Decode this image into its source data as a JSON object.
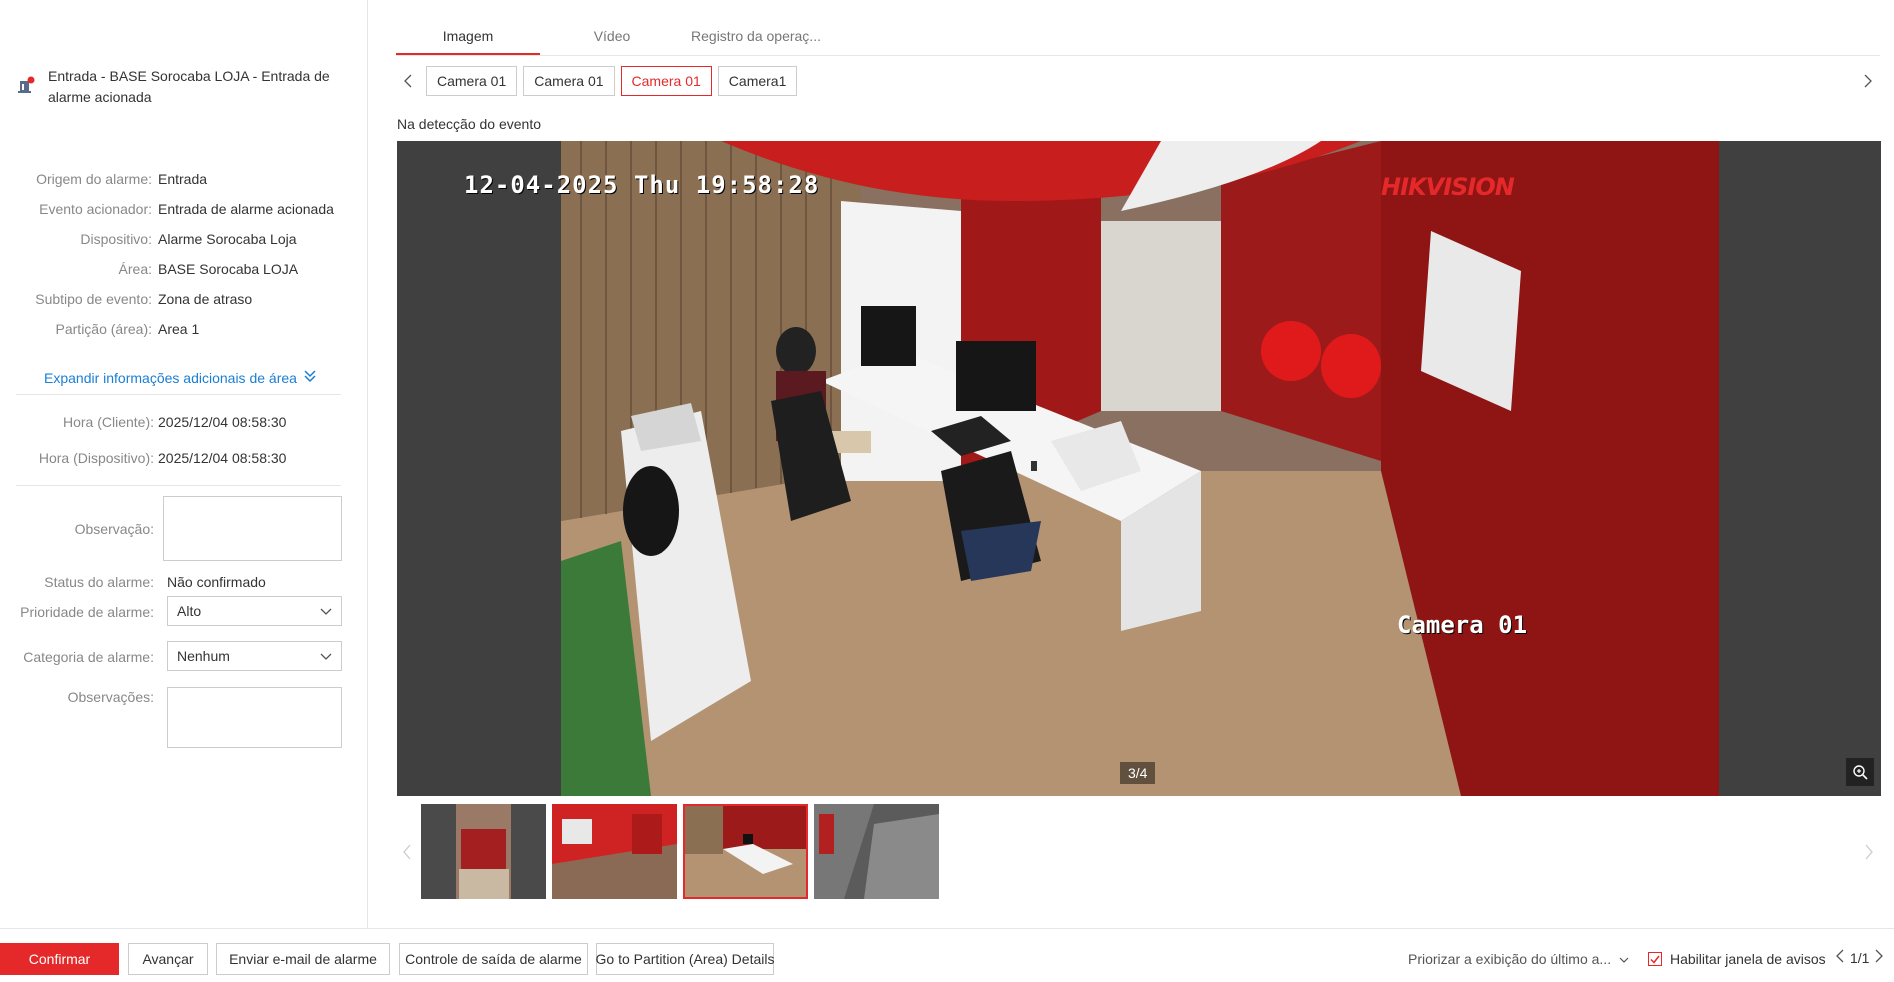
{
  "alarm": {
    "title": "Entrada - BASE Sorocaba LOJA - Entrada de alarme acionada"
  },
  "details": [
    {
      "label": "Origem do alarme:",
      "value": "Entrada"
    },
    {
      "label": "Evento acionador:",
      "value": "Entrada de alarme acionada"
    },
    {
      "label": "Dispositivo:",
      "value": "Alarme Sorocaba Loja"
    },
    {
      "label": "Área:",
      "value": "BASE Sorocaba LOJA"
    },
    {
      "label": "Subtipo de evento:",
      "value": "Zona de atraso"
    },
    {
      "label": "Partição (área):",
      "value": "Area 1"
    }
  ],
  "expand_label": "Expandir informações adicionais de área",
  "times": [
    {
      "label": "Hora (Cliente):",
      "value": "2025/12/04 08:58:30"
    },
    {
      "label": "Hora (Dispositivo):",
      "value": "2025/12/04 08:58:30"
    }
  ],
  "form": {
    "observation_label": "Observação:",
    "status_label": "Status do alarme:",
    "status_value": "Não confirmado",
    "priority_label": "Prioridade de alarme:",
    "priority_value": "Alto",
    "category_label": "Categoria de alarme:",
    "category_value": "Nenhum",
    "remarks_label": "Observações:"
  },
  "tabs": [
    "Imagem",
    "Vídeo",
    "Registro da operaç..."
  ],
  "cameras": [
    "Camera 01",
    "Camera 01",
    "Camera 01",
    "Camera1"
  ],
  "active_camera_index": 2,
  "detect_label": "Na detecção do evento",
  "osd": {
    "timestamp": "12-04-2025 Thu 19:58:28",
    "brand": "HIKVISION",
    "camera": "Camera 01"
  },
  "counter": "3/4",
  "buttons": {
    "confirm": "Confirmar",
    "advance": "Avançar",
    "email": "Enviar e-mail de alarme",
    "output": "Controle de saída de alarme",
    "partition": "Go to Partition (Area) Details"
  },
  "prioritize_label": "Priorizar a exibição do último a...",
  "enable_popup_label": "Habilitar janela de avisos",
  "pager_label": "1/1",
  "colors": {
    "accent": "#e5292a",
    "link": "#1a7ed4"
  }
}
